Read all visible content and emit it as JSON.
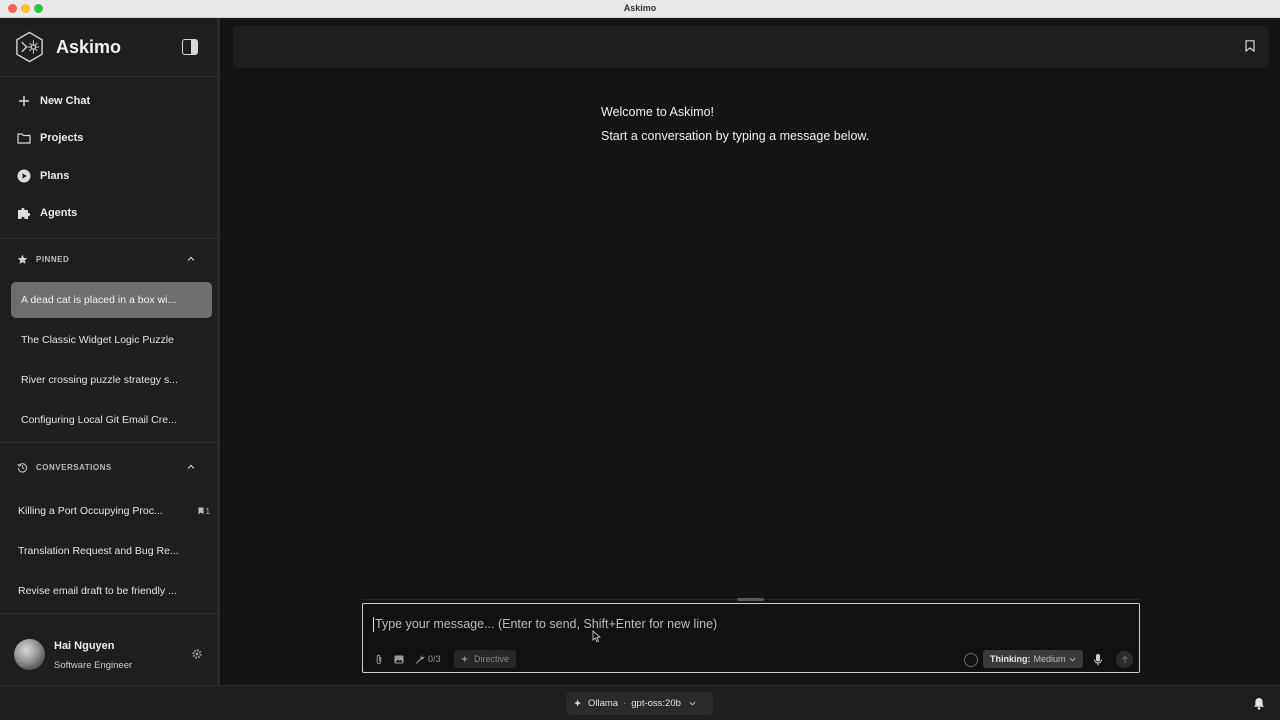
{
  "window": {
    "title": "Askimo"
  },
  "sidebar": {
    "app_name": "Askimo",
    "nav": [
      {
        "label": "New Chat",
        "icon": "plus-icon"
      },
      {
        "label": "Projects",
        "icon": "folder-icon"
      },
      {
        "label": "Plans",
        "icon": "play-circle-icon"
      },
      {
        "label": "Agents",
        "icon": "puzzle-icon"
      }
    ],
    "pinned": {
      "header": "PINNED",
      "items": [
        "A dead cat is placed in a box wi...",
        "The Classic Widget Logic Puzzle",
        "River crossing puzzle strategy s...",
        "Configuring Local Git Email Cre..."
      ],
      "active_index": 0
    },
    "conversations": {
      "header": "CONVERSATIONS",
      "items": [
        {
          "label": "Killing a Port Occupying Proc...",
          "badge": "1"
        },
        {
          "label": "Translation Request and Bug Re..."
        },
        {
          "label": "Revise email draft to be friendly ..."
        }
      ]
    },
    "user": {
      "name": "Hai Nguyen",
      "role": "Software Engineer"
    }
  },
  "main": {
    "welcome_title": "Welcome to Askimo!",
    "welcome_subtitle": "Start a conversation by typing a message below."
  },
  "composer": {
    "placeholder": "Type your message... (Enter to send, Shift+Enter for new line)",
    "tools_count": "0/3",
    "directive_label": "Directive",
    "thinking_label": "Thinking:",
    "thinking_value": "Medium"
  },
  "bottombar": {
    "provider": "Ollama",
    "separator": "·",
    "model": "gpt-oss:20b"
  }
}
